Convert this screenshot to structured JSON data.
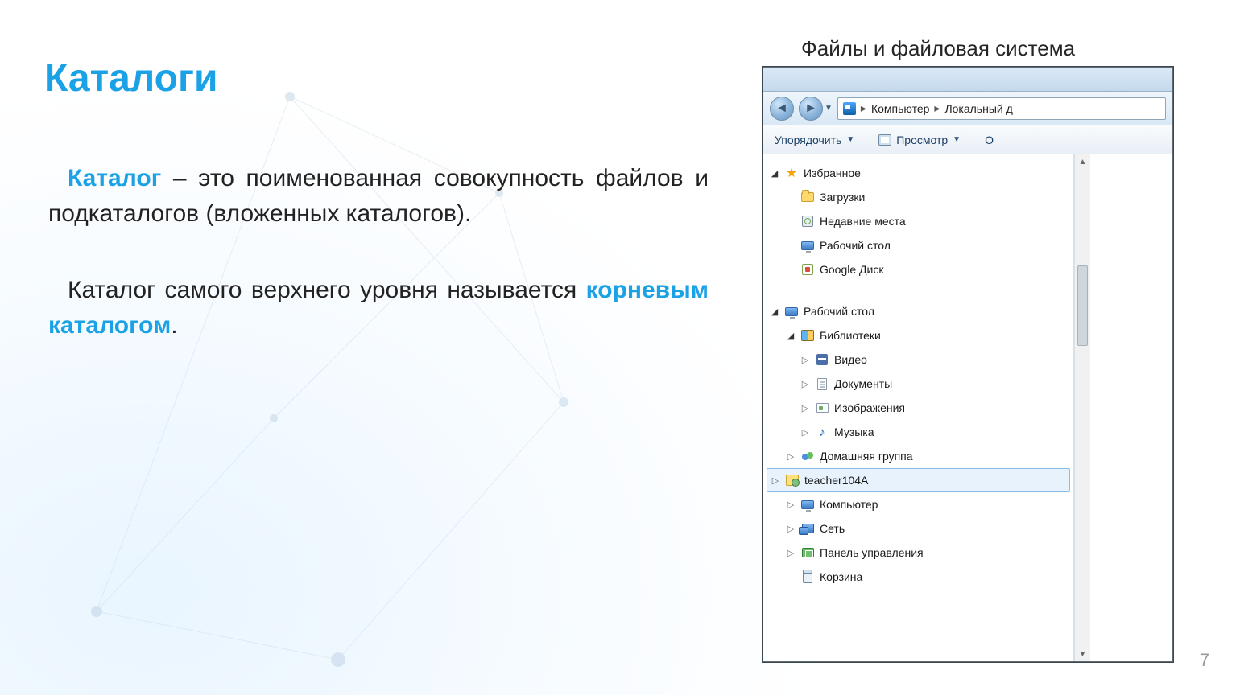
{
  "slide": {
    "header": "Файлы и файловая система",
    "title": "Каталоги",
    "para1_kw": "Каталог",
    "para1_rest": " – это поименованная совокупность файлов и подкаталогов (вложенных каталогов).",
    "para2_pre": "Каталог самого верхнего уровня называется ",
    "para2_kw": "корневым каталогом",
    "para2_post": ".",
    "page_number": "7"
  },
  "explorer": {
    "breadcrumb": {
      "seg1": "Компьютер",
      "seg2": "Локальный д"
    },
    "toolbar": {
      "organize": "Упорядочить",
      "view": "Просмотр",
      "open": "О"
    },
    "tree": {
      "favorites": {
        "label": "Избранное"
      },
      "downloads": {
        "label": "Загрузки"
      },
      "recent": {
        "label": "Недавние места"
      },
      "desktop_fav": {
        "label": "Рабочий стол"
      },
      "gdrive": {
        "label": "Google Диск"
      },
      "desktop": {
        "label": "Рабочий стол"
      },
      "libraries": {
        "label": "Библиотеки"
      },
      "video": {
        "label": "Видео"
      },
      "documents": {
        "label": "Документы"
      },
      "pictures": {
        "label": "Изображения"
      },
      "music": {
        "label": "Музыка"
      },
      "homegroup": {
        "label": "Домашняя группа"
      },
      "user": {
        "label": "teacher104A"
      },
      "computer": {
        "label": "Компьютер"
      },
      "network": {
        "label": "Сеть"
      },
      "controlpanel": {
        "label": "Панель управления"
      },
      "recyclebin": {
        "label": "Корзина"
      }
    }
  }
}
